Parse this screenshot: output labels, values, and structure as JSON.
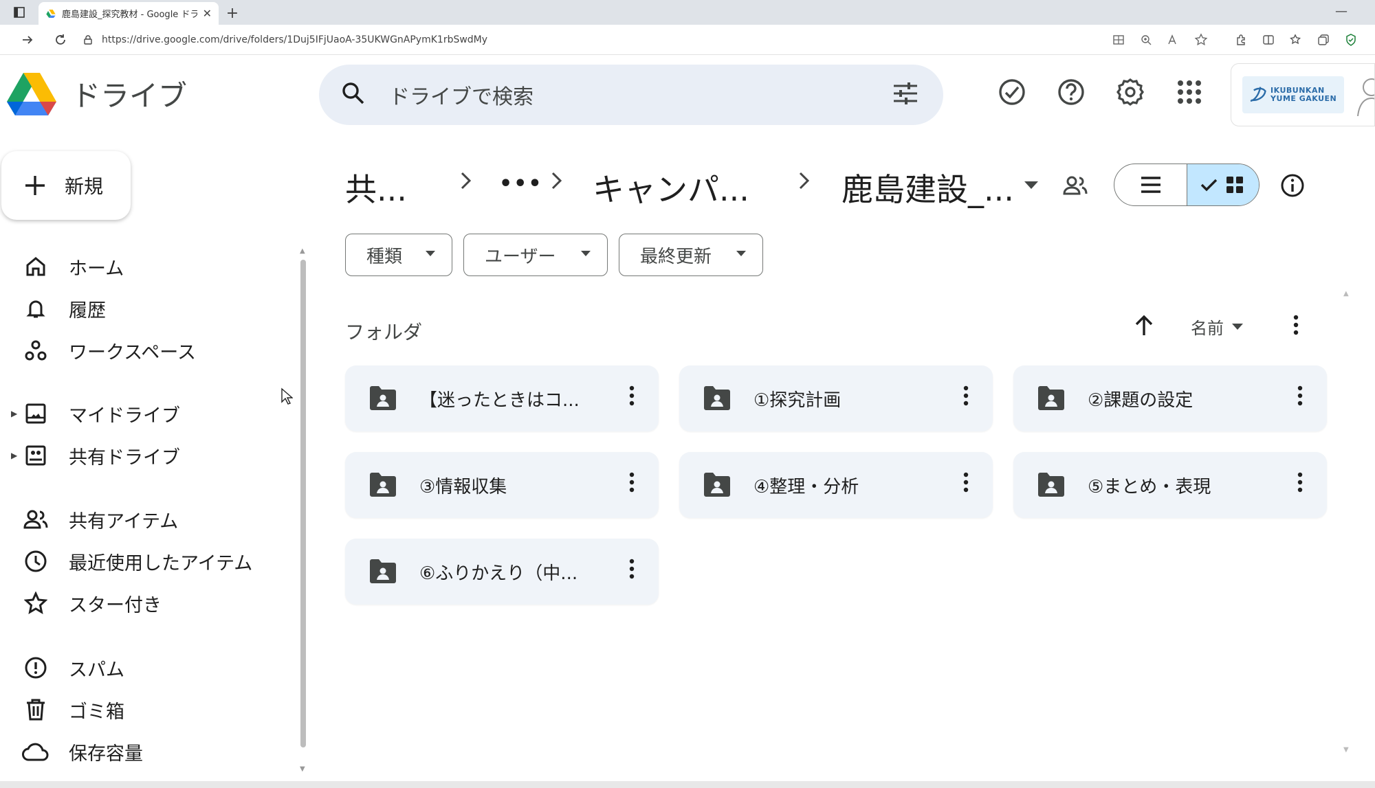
{
  "browser": {
    "tab_title": "鹿島建設_探究教材 - Google ドライブ",
    "url": "https://drive.google.com/drive/folders/1Duj5IFjUaoA-35UKWGnAPymK1rbSwdMy"
  },
  "drive": {
    "brand": "ドライブ",
    "search_placeholder": "ドライブで検索",
    "org_logo_text": "IKUBUNKAN YUME GAKUEN"
  },
  "sidebar": {
    "new_label": "新規",
    "items": [
      {
        "id": "home",
        "label": "ホーム"
      },
      {
        "id": "activity",
        "label": "履歴"
      },
      {
        "id": "workspaces",
        "label": "ワークスペース"
      },
      {
        "id": "my-drive",
        "label": "マイドライブ"
      },
      {
        "id": "shared-drives",
        "label": "共有ドライブ"
      },
      {
        "id": "shared-with-me",
        "label": "共有アイテム"
      },
      {
        "id": "recent",
        "label": "最近使用したアイテム"
      },
      {
        "id": "starred",
        "label": "スター付き"
      },
      {
        "id": "spam",
        "label": "スパム"
      },
      {
        "id": "trash",
        "label": "ゴミ箱"
      },
      {
        "id": "storage",
        "label": "保存容量"
      }
    ]
  },
  "breadcrumb": {
    "items": [
      "共...",
      "•••",
      "キャンパ...",
      "鹿島建設_..."
    ]
  },
  "filters": {
    "type": "種類",
    "people": "ユーザー",
    "modified": "最終更新"
  },
  "folders_section": {
    "title": "フォルダ",
    "sort_label": "名前",
    "folders": [
      "【迷ったときはコ...",
      "①探究計画",
      "②課題の設定",
      "③情報収集",
      "④整理・分析",
      "⑤まとめ・表現",
      "⑥ふりかえり（中..."
    ]
  },
  "colors": {
    "search_bg": "#e9eef6",
    "card_bg": "#f0f4f9",
    "toggle_active": "#c2e7ff",
    "icon_gray": "#444746"
  }
}
